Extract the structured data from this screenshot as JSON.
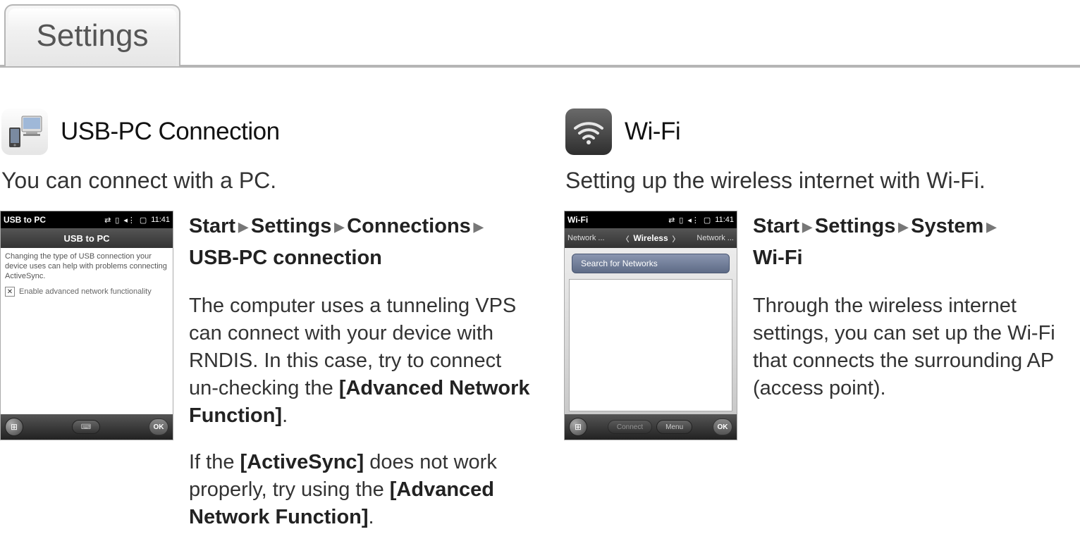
{
  "header": {
    "tab_label": "Settings"
  },
  "usb": {
    "section_title": "USB-PC Connection",
    "intro": "You can connect with a PC.",
    "path": [
      "Start",
      "Settings",
      "Connections",
      "USB-PC connection"
    ],
    "para1_prefix": "The computer uses a tunneling VPS can connect with your device with RNDIS. In this case, try to connect un-checking the ",
    "para1_bold": "[Advanced Network Function]",
    "para1_suffix": ".",
    "para2_prefix": "If the ",
    "para2_bold1": "[ActiveSync]",
    "para2_mid": " does not work properly, try using the ",
    "para2_bold2": "[Advanced Network Function]",
    "para2_suffix": ".",
    "screenshot": {
      "status_title": "USB to PC",
      "status_time": "11:41",
      "titlebar": "USB to PC",
      "body_text": "Changing the type of USB connection your device uses can help with problems connecting ActiveSync.",
      "checkbox_label": "Enable advanced network functionality",
      "ok_label": "OK"
    }
  },
  "wifi": {
    "section_title": "Wi-Fi",
    "intro": "Setting up the wireless internet with Wi-Fi.",
    "path": [
      "Start",
      "Settings",
      "System",
      "Wi-Fi"
    ],
    "para_text": "Through the wireless internet settings, you can set up the Wi-Fi that connects the surrounding AP (access point).",
    "screenshot": {
      "status_title": "Wi-Fi",
      "status_time": "11:41",
      "tab_left": "Network ...",
      "tab_center": "Wireless",
      "tab_right": "Network ...",
      "search_label": "Search for Networks",
      "connect_label": "Connect",
      "menu_label": "Menu",
      "ok_label": "OK"
    }
  }
}
